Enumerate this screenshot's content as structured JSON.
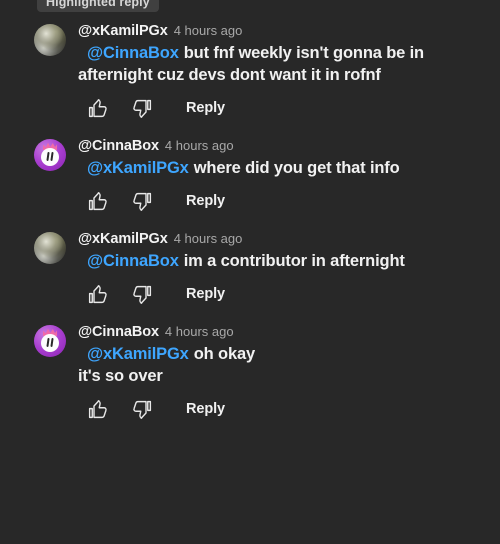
{
  "badge": {
    "label": "Highlighted reply"
  },
  "colors": {
    "background": "#282828",
    "badge_background": "#404040",
    "text": "#f1f1f1",
    "timestamp": "#a8a8a8",
    "mention_link": "#3ea6ff",
    "cinnabox_avatar": "#a93fd0",
    "cinnabox_crown": "#f06aa8"
  },
  "actions": {
    "like_icon": "thumb-up-outline-icon",
    "dislike_icon": "thumb-down-outline-icon",
    "reply_label": "Reply"
  },
  "comments": [
    {
      "author": "@xKamilPGx",
      "timestamp": "4 hours ago",
      "avatar": "photo",
      "mention": "@CinnaBox",
      "text": "but fnf weekly isn't gonna be in afternight cuz devs dont want it in rofnf"
    },
    {
      "author": "@CinnaBox",
      "timestamp": "4 hours ago",
      "avatar": "cinna",
      "mention": "@xKamilPGx",
      "text": "where did you get that info"
    },
    {
      "author": "@xKamilPGx",
      "timestamp": "4 hours ago",
      "avatar": "photo",
      "mention": "@CinnaBox",
      "text": "im a contributor in afternight"
    },
    {
      "author": "@CinnaBox",
      "timestamp": "4 hours ago",
      "avatar": "cinna",
      "mention": "@xKamilPGx",
      "text": "oh okay\nit's so over"
    }
  ]
}
